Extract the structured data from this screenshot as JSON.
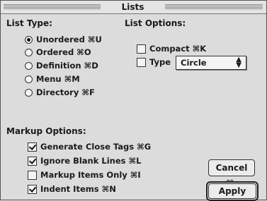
{
  "window": {
    "title": "Lists"
  },
  "list_type": {
    "label": "List Type:",
    "options": [
      {
        "label": "Unordered ⌘U",
        "selected": true
      },
      {
        "label": "Ordered ⌘O",
        "selected": false
      },
      {
        "label": "Definition ⌘D",
        "selected": false
      },
      {
        "label": "Menu ⌘M",
        "selected": false
      },
      {
        "label": "Directory ⌘F",
        "selected": false
      }
    ]
  },
  "list_options": {
    "label": "List Options:",
    "compact": {
      "label": "Compact ⌘K",
      "checked": false
    },
    "type": {
      "label": "Type",
      "checked": false,
      "value": "Circle"
    }
  },
  "markup_options": {
    "label": "Markup Options:",
    "items": [
      {
        "label": "Generate Close Tags ⌘G",
        "checked": true
      },
      {
        "label": "Ignore Blank Lines ⌘L",
        "checked": true
      },
      {
        "label": "Markup Items Only ⌘I",
        "checked": false
      },
      {
        "label": "Indent Items ⌘N",
        "checked": true
      }
    ]
  },
  "buttons": {
    "cancel": "Cancel ⌘.",
    "apply": "Apply"
  }
}
